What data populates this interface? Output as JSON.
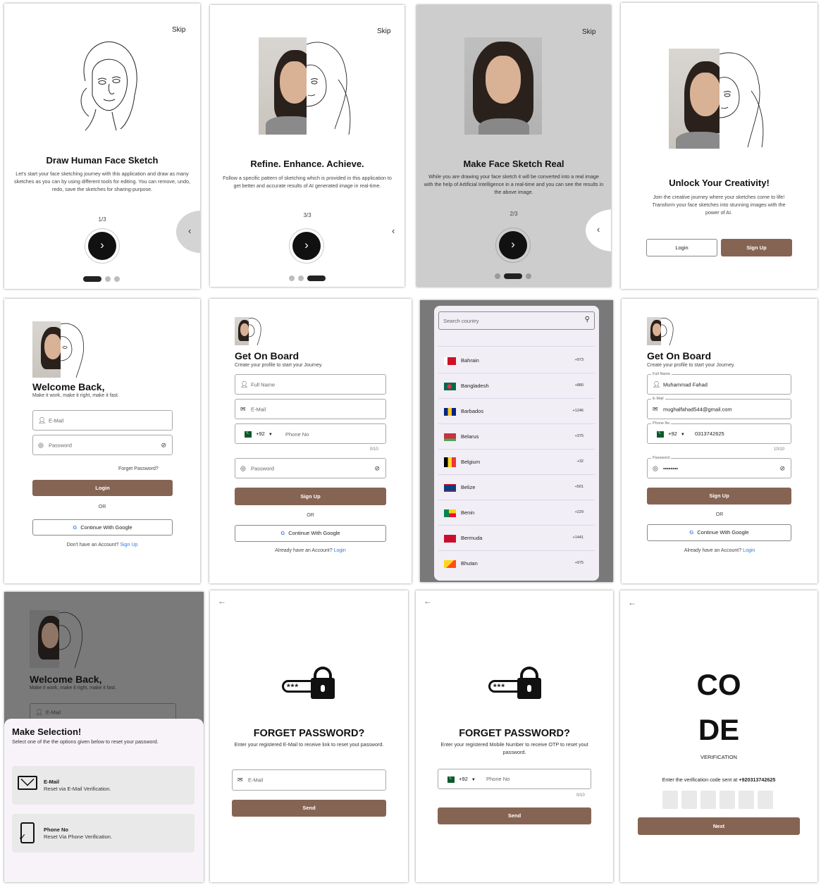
{
  "colors": {
    "brand": "#866453",
    "dark": "#111111",
    "link": "#2a7ae2",
    "overlay": "#7a7a7a"
  },
  "onboarding1": {
    "skip": "Skip",
    "title": "Draw Human Face Sketch",
    "body": "Let's start your face sketching journey with this application and draw as many sketches as you can by using different tools for editing. You can remove, undo, redo, save the sketches for sharing-purpose.",
    "page": "1/3"
  },
  "onboarding3": {
    "skip": "Skip",
    "title": "Refine. Enhance. Achieve.",
    "body": "Follow a specific pattern of sketching which is provided in this application to get better and accurate results of AI generated image in real-time.",
    "page": "3/3"
  },
  "onboarding2": {
    "skip": "Skip",
    "title": "Make Face Sketch Real",
    "body": "While you are drawing your face sketch it will be converted into a real image with the help of Artificial Intelligence in a real-time and you can see the results in the above image.",
    "page": "2/3"
  },
  "welcome": {
    "title": "Unlock Your Creativity!",
    "body": "Join the creative journey where your sketches come to life! Transform your face sketches into stunning images with the power of AI.",
    "login": "Login",
    "signup": "Sign Up"
  },
  "login": {
    "title": "Welcome Back,",
    "subtitle": "Make it work, make it right, make it fast.",
    "email_ph": "E-Mail",
    "password_ph": "Password",
    "forgot": "Forget Password?",
    "login_btn": "Login",
    "or": "OR",
    "google": "Continue With Google",
    "no_account": "Don't have an Account?",
    "signup_link": "Sign Up"
  },
  "signup": {
    "title": "Get On Board",
    "subtitle": "Create your profile to start your Journey.",
    "fullname_ph": "Full Name",
    "email_ph": "E-Mail",
    "code": "+92",
    "phone_ph": "Phone No",
    "counter": "0/10",
    "password_ph": "Password",
    "signup_btn": "Sign Up",
    "or": "OR",
    "google": "Continue With Google",
    "have_account": "Already have an Account?",
    "login_link": "Login"
  },
  "country_picker": {
    "search_ph": "Search country",
    "countries": [
      {
        "name": "Bahrain",
        "code": "+973"
      },
      {
        "name": "Bangladesh",
        "code": "+880"
      },
      {
        "name": "Barbados",
        "code": "+1246"
      },
      {
        "name": "Belarus",
        "code": "+375"
      },
      {
        "name": "Belgium",
        "code": "+32"
      },
      {
        "name": "Belize",
        "code": "+501"
      },
      {
        "name": "Benin",
        "code": "+229"
      },
      {
        "name": "Bermuda",
        "code": "+1441"
      },
      {
        "name": "Bhutan",
        "code": "+975"
      }
    ]
  },
  "signup_filled": {
    "title": "Get On Board",
    "subtitle": "Create your profile to start your Journey.",
    "fullname_label": "Full Name",
    "fullname": "Muhammad Fahad",
    "email_label": "E-Mail",
    "email": "mughalfahad544@gmail.com",
    "phone_label": "Phone No",
    "code": "+92",
    "phone": "0313742625",
    "counter": "10/10",
    "password_label": "Password",
    "password": "••••••••",
    "signup_btn": "Sign Up",
    "or": "OR",
    "google": "Continue With Google",
    "have_account": "Already have an Account?",
    "login_link": "Login"
  },
  "selection": {
    "bg_title": "Welcome Back,",
    "bg_subtitle": "Make it work, make it right, make it fast.",
    "bg_email_ph": "E-Mail",
    "title": "Make Selection!",
    "subtitle": "Select one of the the options given below to reset your password.",
    "email_title": "E-Mail",
    "email_desc": "Reset via E-Mail Verification.",
    "phone_title": "Phone No",
    "phone_desc": "Reset Via Phone Verification."
  },
  "forgot_email": {
    "title": "FORGET PASSWORD?",
    "body": "Enter your registered E-Mail to receive link to reset yout password.",
    "email_ph": "E-Mail",
    "send": "Send",
    "stars": "***"
  },
  "forgot_phone": {
    "title": "FORGET PASSWORD?",
    "body": "Enter your registered Mobile Number to receive OTP to reset yout password.",
    "code": "+92",
    "phone_ph": "Phone No",
    "counter": "0/10",
    "send": "Send",
    "stars": "***"
  },
  "verify": {
    "code_line1": "CO",
    "code_line2": "DE",
    "label": "VERIFICATION",
    "sent_text": "Enter the verification code sent at",
    "number": "+920313742625",
    "next": "Next"
  }
}
